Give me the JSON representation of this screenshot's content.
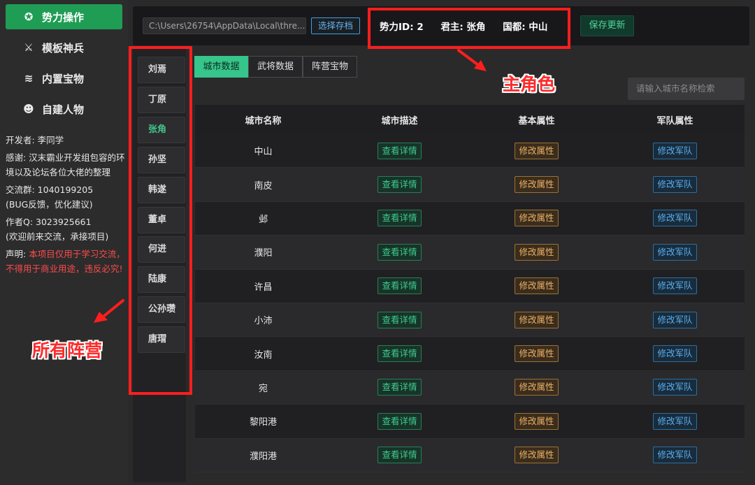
{
  "nav": {
    "items": [
      {
        "label": "势力操作",
        "icon": "swirl-icon",
        "glyph": "✪",
        "active": true
      },
      {
        "label": "模板神兵",
        "icon": "weapon-icon",
        "glyph": "⚔",
        "active": false
      },
      {
        "label": "内置宝物",
        "icon": "layers-icon",
        "glyph": "≋",
        "active": false
      },
      {
        "label": "自建人物",
        "icon": "person-icon",
        "glyph": "☻",
        "active": false
      }
    ]
  },
  "info": {
    "developer": "开发者: 李同学",
    "thanks": "感谢: 汉末霸业开发组包容的环境以及论坛各位大佬的整理",
    "group": "交流群:  1040199205",
    "group_note": "(BUG反馈，优化建议)",
    "author_qq": "作者Q:  3023925661",
    "author_note": "(欢迎前来交流，承接项目)",
    "disclaimer_prefix": "声明: ",
    "disclaimer": "本项目仅用于学习交流，不得用于商业用途，违反必究!"
  },
  "topbar": {
    "path_value": "C:\\Users\\26754\\AppData\\Local\\thre...",
    "choose_label": "选择存档",
    "faction_id": "势力ID:  2",
    "ruler": "君主:  张角",
    "capital": "国都:  中山",
    "save_label": "保存更新"
  },
  "factions": [
    "刘焉",
    "丁原",
    "张角",
    "孙坚",
    "韩遂",
    "董卓",
    "何进",
    "陆康",
    "公孙瓒",
    "唐瑁"
  ],
  "active_faction": "张角",
  "tabs": [
    "城市数据",
    "武将数据",
    "阵营宝物"
  ],
  "search": {
    "placeholder": "请输入城市名称检索"
  },
  "table": {
    "headers": [
      "城市名称",
      "城市描述",
      "基本属性",
      "军队属性"
    ],
    "rows": [
      "中山",
      "南皮",
      "邺",
      "濮阳",
      "许昌",
      "小沛",
      "汝南",
      "宛",
      "黎阳港",
      "濮阳港"
    ],
    "detail_label": "查看详情",
    "attr_label": "修改属性",
    "army_label": "修改军队"
  },
  "annotations": {
    "main_role": "主角色",
    "all_factions": "所有阵营"
  },
  "colors": {
    "accent_green": "#1f9d55",
    "annotation_red": "#ff1e1e"
  }
}
